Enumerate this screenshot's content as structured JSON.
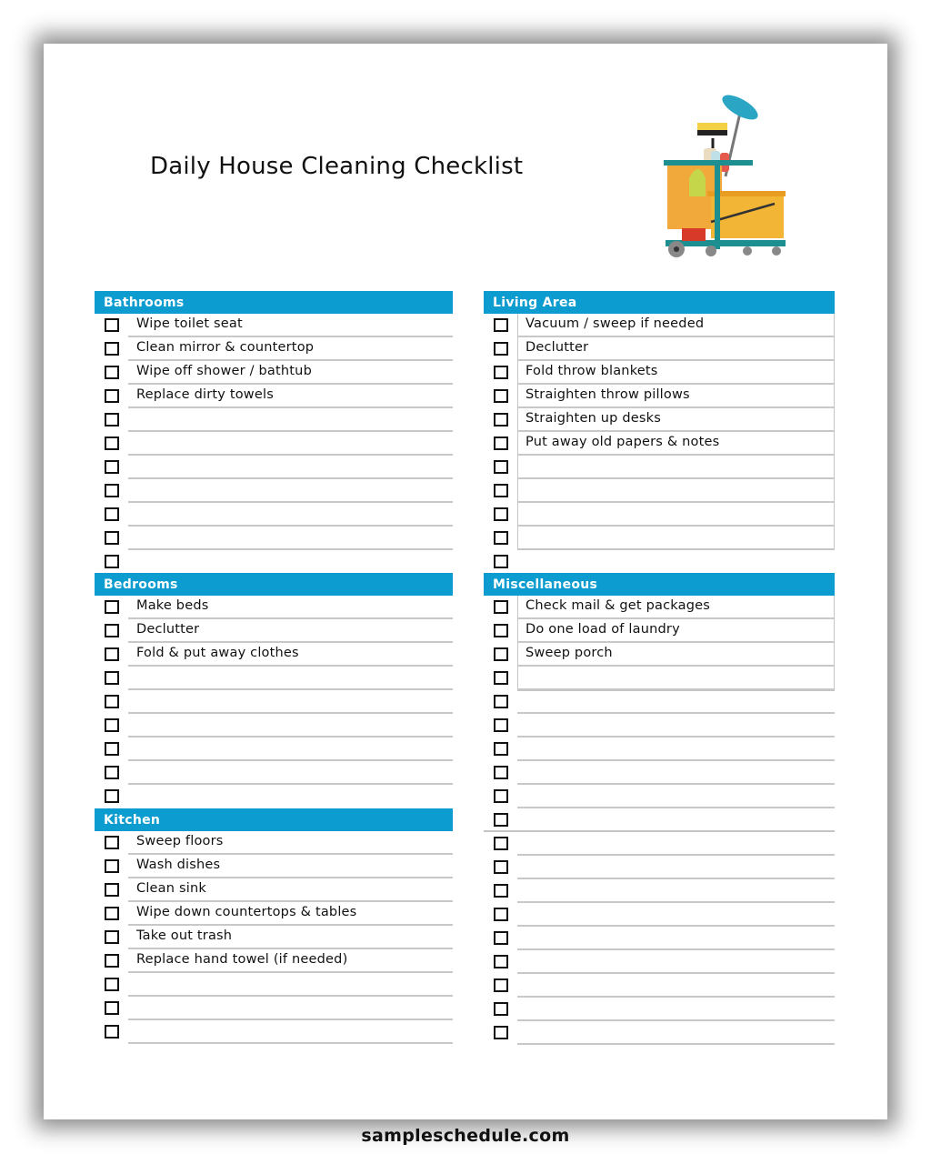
{
  "title": "Daily House Cleaning Checklist",
  "footer": "sampleschedule.com",
  "accent_color": "#0d9ccf",
  "illustration": "cleaning-cart-icon",
  "sections": {
    "bathrooms": {
      "label": "Bathrooms",
      "items": [
        "Wipe toilet seat",
        "Clean mirror & countertop",
        "Wipe off shower / bathtub",
        "Replace dirty towels",
        "",
        "",
        "",
        "",
        "",
        "",
        ""
      ]
    },
    "bedrooms": {
      "label": "Bedrooms",
      "items": [
        "Make beds",
        "Declutter",
        "Fold & put away clothes",
        "",
        "",
        "",
        "",
        "",
        ""
      ]
    },
    "kitchen": {
      "label": "Kitchen",
      "items": [
        "Sweep floors",
        "Wash dishes",
        "Clean sink",
        "Wipe down countertops & tables",
        "Take out trash",
        "Replace hand towel (if needed)",
        "",
        "",
        ""
      ]
    },
    "living_area": {
      "label": "Living Area",
      "items": [
        "Vacuum / sweep if needed",
        "Declutter",
        "Fold throw blankets",
        "Straighten throw pillows",
        "Straighten up desks",
        "Put away old papers & notes",
        "",
        "",
        "",
        "",
        ""
      ]
    },
    "miscellaneous": {
      "label": "Miscellaneous",
      "items": [
        "Check mail & get packages",
        "Do one load of laundry",
        "Sweep porch",
        "",
        "",
        "",
        "",
        "",
        "",
        "",
        "",
        "",
        "",
        "",
        "",
        "",
        "",
        "",
        ""
      ]
    }
  }
}
